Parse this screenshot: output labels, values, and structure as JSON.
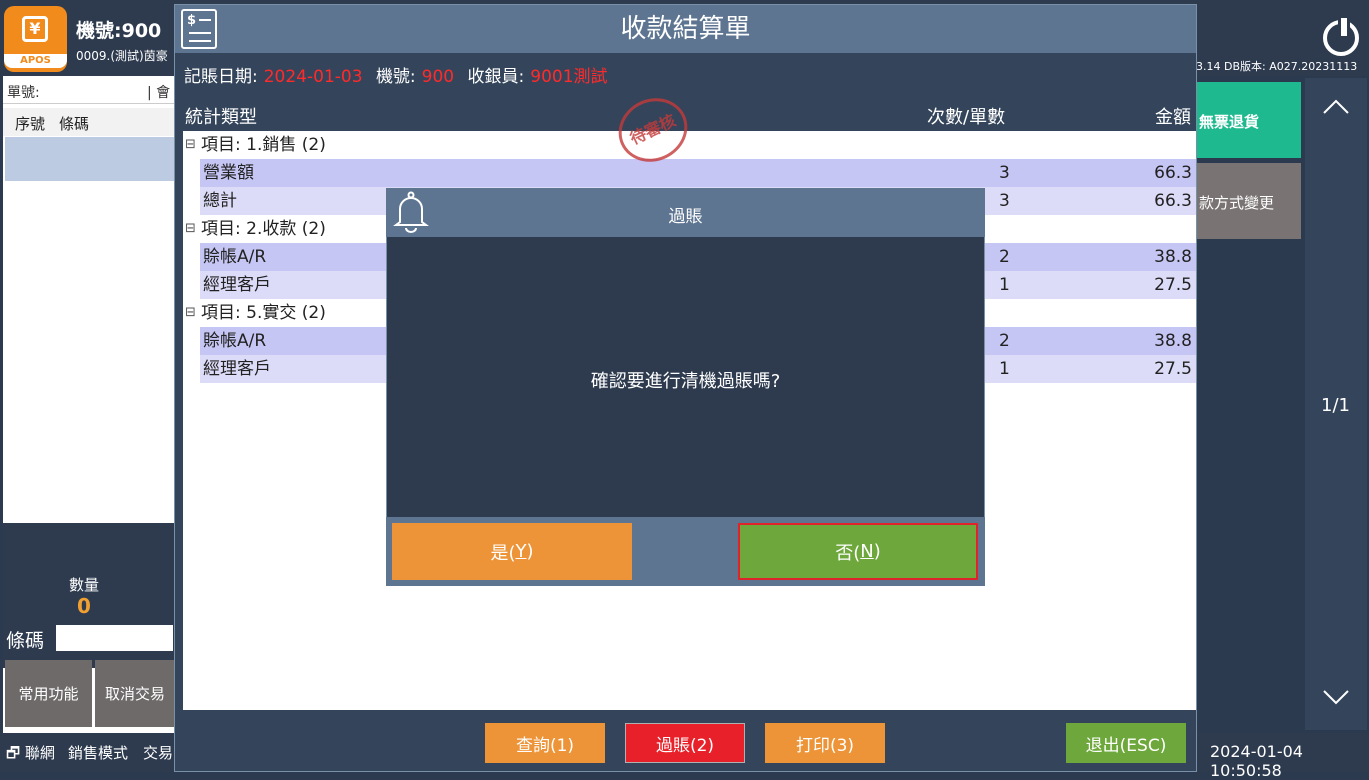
{
  "app": {
    "machine_label": "機號:900",
    "store_name": "0009.(測試)茵豪",
    "logo_text": "APOS",
    "db_version": "3.14 DB版本: A027.20231113",
    "order_label": "單號:",
    "member_label": "會",
    "col_seq": "序號",
    "col_barcode": "條碼",
    "qty_label": "數量",
    "qty_value": "0",
    "barcode_label": "條碼",
    "fn_common": "常用功能",
    "fn_cancel": "取消交易",
    "status_net": "聯網",
    "status_mode": "銷售模式",
    "status_trade": "交易",
    "btn_no_invoice_return": "無票退貨",
    "btn_payment_change": "款方式變更",
    "page_indicator": "1/1",
    "clock": "2024-01-04 10:50:58"
  },
  "window": {
    "title": "收款結算單",
    "date_label": "記賬日期:",
    "date_value": "2024-01-03",
    "machine_label": "機號:",
    "machine_value": "900",
    "cashier_label": "收銀員:",
    "cashier_value": "9001測試",
    "stamp": "待審核",
    "headers": {
      "type": "統計類型",
      "count": "次數/單數",
      "amount": "金額"
    },
    "groups": [
      {
        "label": "項目: 1.銷售 (2)",
        "rows": [
          {
            "name": "營業額",
            "count": "3",
            "amount": "66.3"
          },
          {
            "name": "總計",
            "count": "3",
            "amount": "66.3"
          }
        ]
      },
      {
        "label": "項目: 2.收款 (2)",
        "rows": [
          {
            "name": "賒帳A/R",
            "count": "2",
            "amount": "38.8"
          },
          {
            "name": "經理客戶",
            "count": "1",
            "amount": "27.5"
          }
        ]
      },
      {
        "label": "項目: 5.實交 (2)",
        "rows": [
          {
            "name": "賒帳A/R",
            "count": "2",
            "amount": "38.8"
          },
          {
            "name": "經理客戶",
            "count": "1",
            "amount": "27.5"
          }
        ]
      }
    ],
    "buttons": {
      "query": "查詢(1)",
      "post": "過賬(2)",
      "print": "打印(3)",
      "exit": "退出(ESC)"
    }
  },
  "dialog": {
    "title": "過賬",
    "message": "確認要進行清機過賬嗎?",
    "yes_text": "是(",
    "yes_key": "Y",
    "no_text": "否(",
    "no_key": "N",
    "close_paren": ")"
  }
}
